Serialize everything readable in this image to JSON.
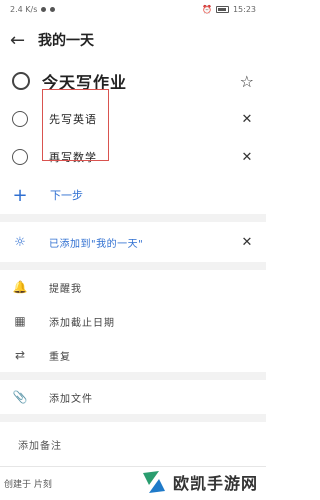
{
  "status_bar": {
    "left_text": "2.4 K/s",
    "time": "15:23"
  },
  "header": {
    "title": "我的一天"
  },
  "task": {
    "title": "今天写作业"
  },
  "steps": [
    {
      "label": "先写英语"
    },
    {
      "label": "再写数学"
    }
  ],
  "next_step": {
    "label": "下一步"
  },
  "my_day": {
    "label": "已添加到\"我的一天\""
  },
  "options": [
    {
      "label": "提醒我",
      "icon": "bell-icon"
    },
    {
      "label": "添加截止日期",
      "icon": "calendar-icon"
    },
    {
      "label": "重复",
      "icon": "repeat-icon"
    }
  ],
  "file": {
    "label": "添加文件"
  },
  "note": {
    "placeholder": "添加备注"
  },
  "footer": {
    "text": "创建于 片刻"
  },
  "watermark": {
    "text": "欧凯手游网"
  },
  "colors": {
    "accent": "#2f6fd1",
    "highlight": "#d9534f"
  }
}
